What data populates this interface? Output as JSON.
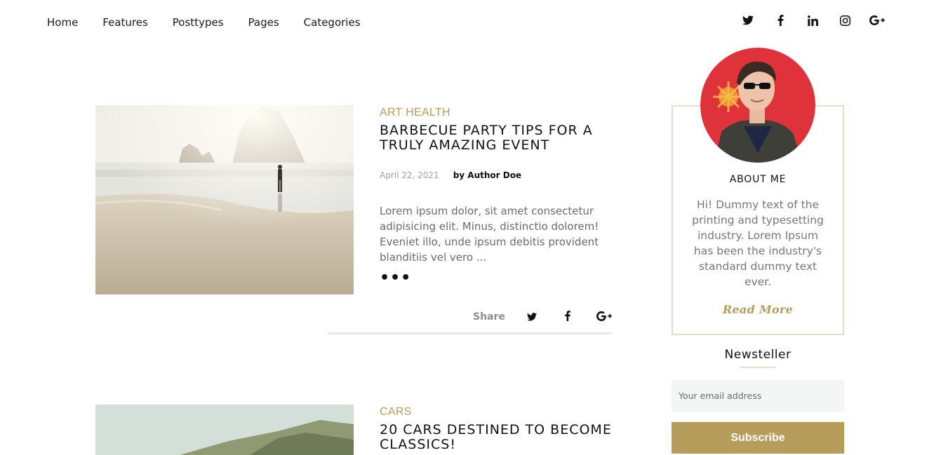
{
  "nav": {
    "items": [
      {
        "label": "Home"
      },
      {
        "label": "Features"
      },
      {
        "label": "Posttypes"
      },
      {
        "label": "Pages"
      },
      {
        "label": "Categories"
      }
    ],
    "social": [
      "twitter-icon",
      "facebook-icon",
      "linkedin-icon",
      "instagram-icon",
      "google-plus-icon"
    ]
  },
  "posts": [
    {
      "category": "ART HEALTH",
      "title": "BARBECUE PARTY TIPS FOR A TRULY AMAZING EVENT",
      "date": "April 22, 2021",
      "author": "by Author Doe",
      "excerpt": "Lorem ipsum dolor, sit amet consectetur adipisicing elit. Minus, distinctio dolorem! Eveniet illo, unde ipsum debitis provident blanditiis vel vero ...",
      "more": "•••",
      "share_label": "Share"
    },
    {
      "category": "CARS",
      "title": "20 CARS DESTINED TO BECOME CLASSICS!"
    }
  ],
  "sidebar": {
    "about_title": "ABOUT ME",
    "about_text": "Hi! Dummy text of the printing and typesetting industry. Lorem Ipsum has been the industry's standard dummy text ever.",
    "read_more": "Read More",
    "newsletter_title": "Newsteller",
    "email_placeholder": "Your email address",
    "subscribe_label": "Subscribe"
  },
  "colors": {
    "accent": "#b69d5b",
    "border": "#e7dcc6"
  }
}
